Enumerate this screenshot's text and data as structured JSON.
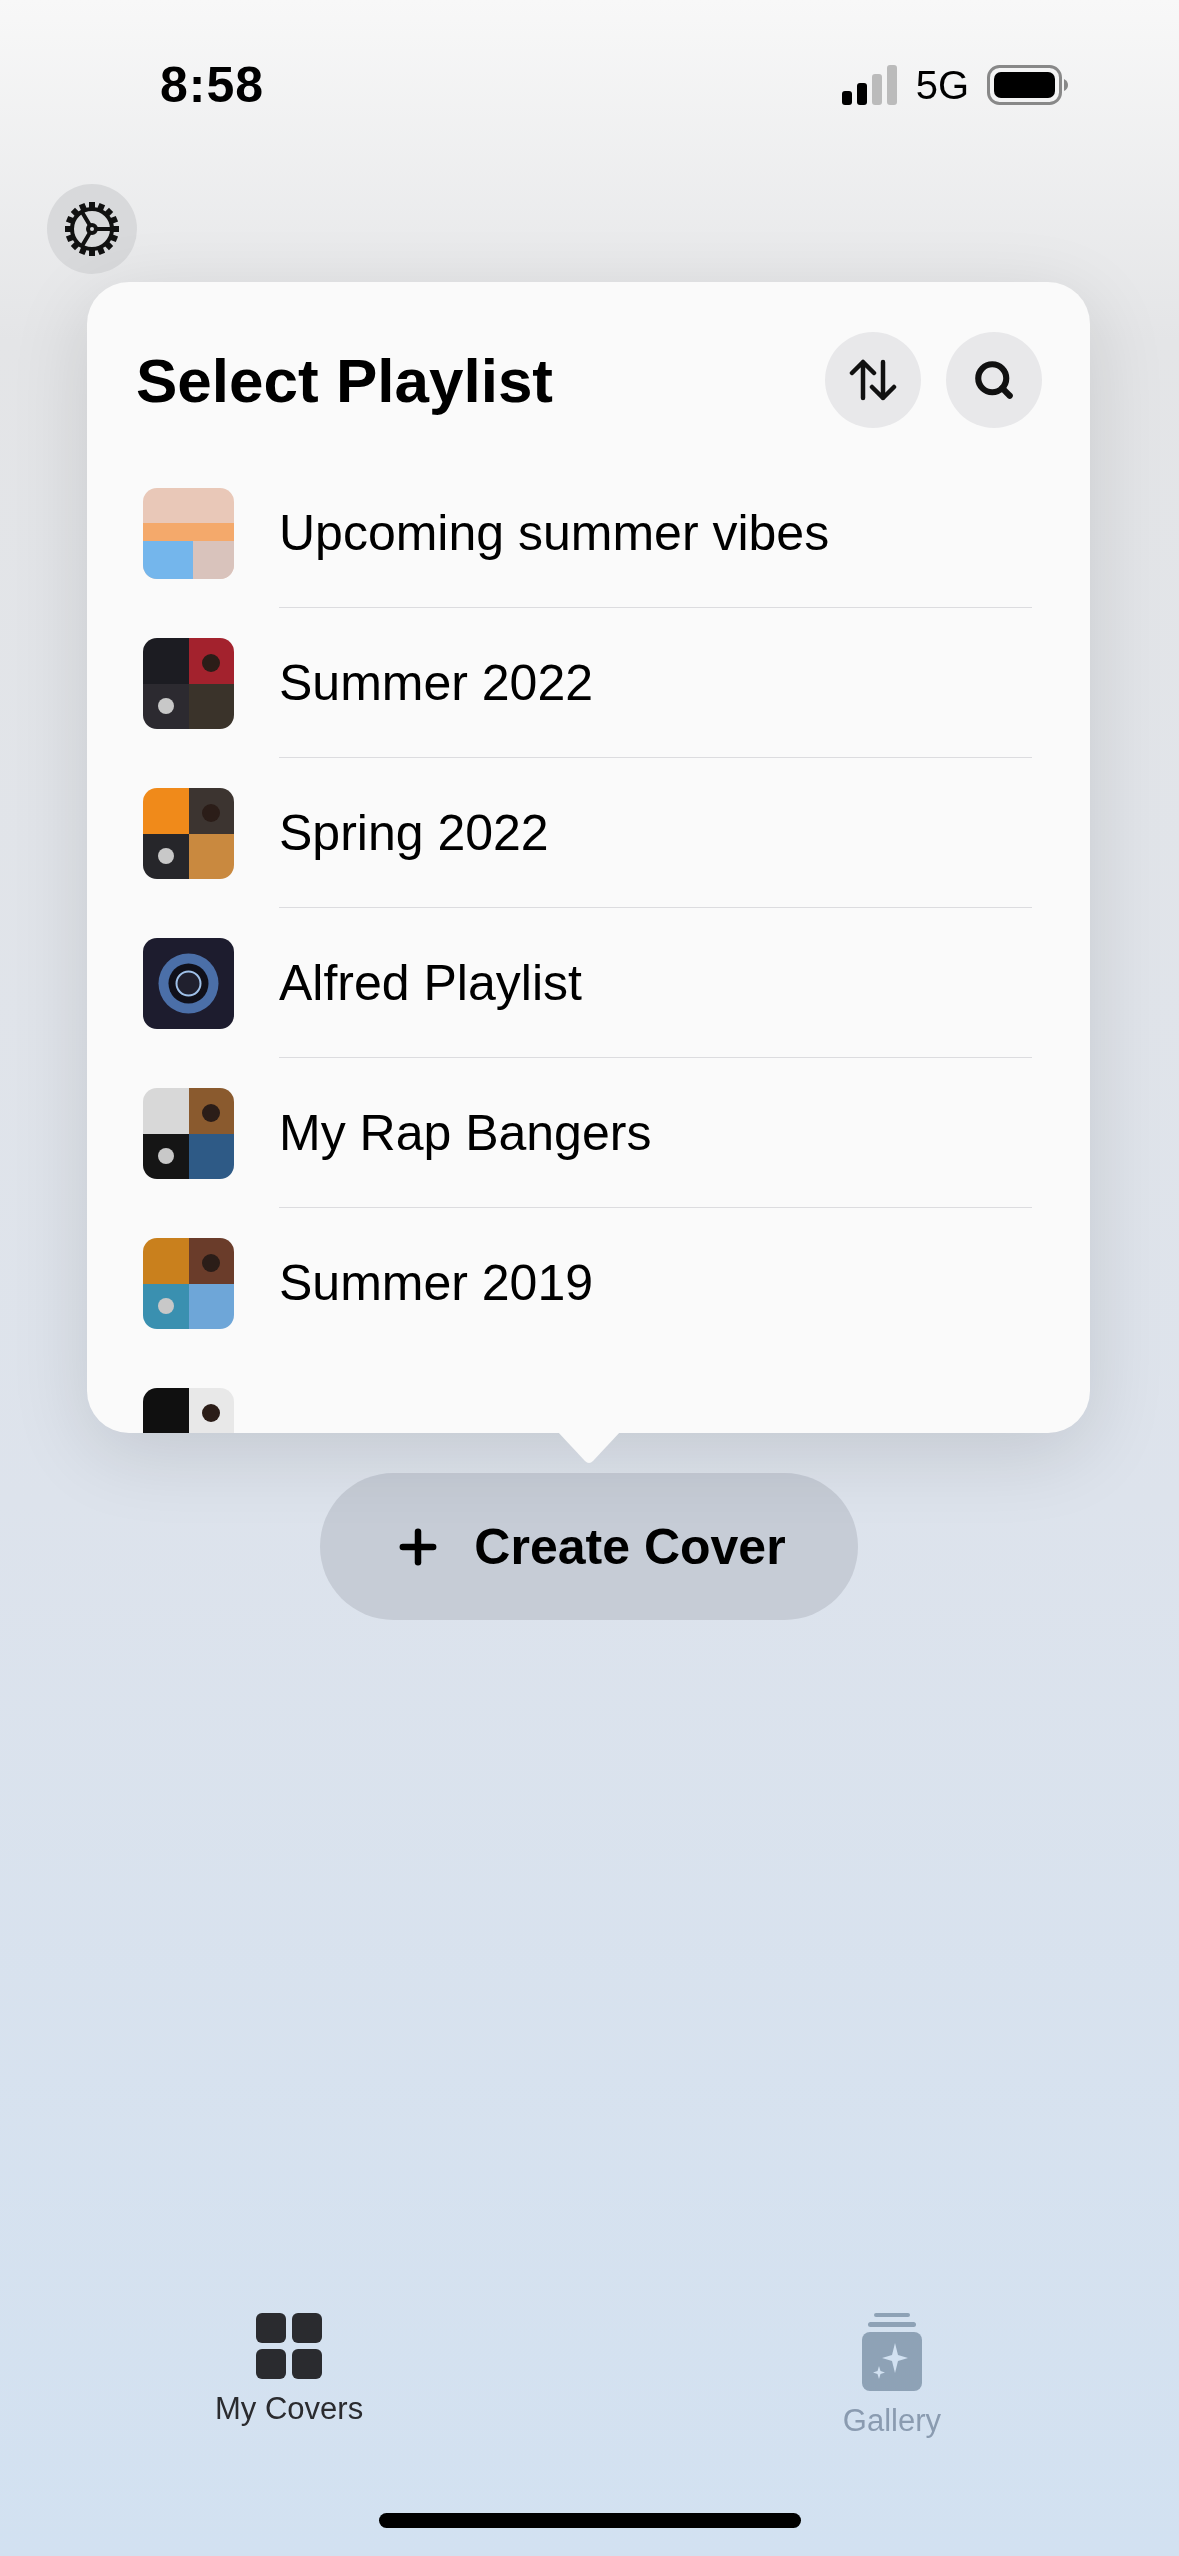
{
  "status_bar": {
    "time": "8:58",
    "network": "5G"
  },
  "popover": {
    "title": "Select Playlist",
    "playlists": [
      {
        "kind": "row",
        "title": "Upcoming summer vibes"
      },
      {
        "kind": "row",
        "title": "Summer 2022"
      },
      {
        "kind": "row",
        "title": "Spring 2022"
      },
      {
        "kind": "row",
        "title": "Alfred Playlist"
      },
      {
        "kind": "row",
        "title": "My Rap Bangers"
      },
      {
        "kind": "row",
        "title": "Summer 2019"
      },
      {
        "kind": "picture"
      }
    ]
  },
  "create_button": {
    "label": "Create Cover"
  },
  "tab_bar": [
    {
      "label": "My Covers",
      "selected": true,
      "kind": "grid"
    },
    {
      "label": "Gallery",
      "selected": false,
      "kind": "gallery"
    }
  ]
}
